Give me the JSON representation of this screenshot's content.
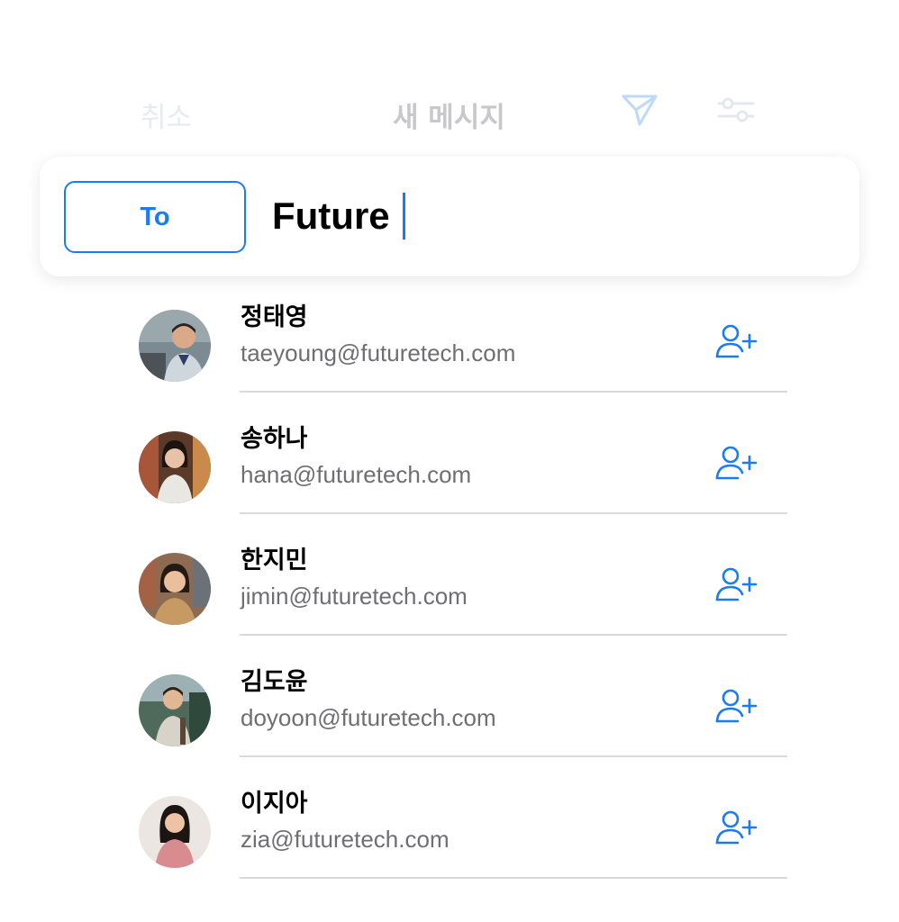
{
  "header": {
    "cancel_label": "취소",
    "title": "새 메시지",
    "send_icon": "send-icon",
    "filter_icon": "sliders-icon"
  },
  "compose": {
    "to_label": "To",
    "query": "Future"
  },
  "contacts": [
    {
      "name": "정태영",
      "email": "taeyoung@futuretech.com"
    },
    {
      "name": "송하나",
      "email": "hana@futuretech.com"
    },
    {
      "name": "한지민",
      "email": "jimin@futuretech.com"
    },
    {
      "name": "김도윤",
      "email": "doyoon@futuretech.com"
    },
    {
      "name": "이지아",
      "email": "zia@futuretech.com"
    }
  ],
  "colors": {
    "accent": "#1a7cf5",
    "secondary_text": "#6e6e73",
    "divider": "#d9d9de"
  }
}
